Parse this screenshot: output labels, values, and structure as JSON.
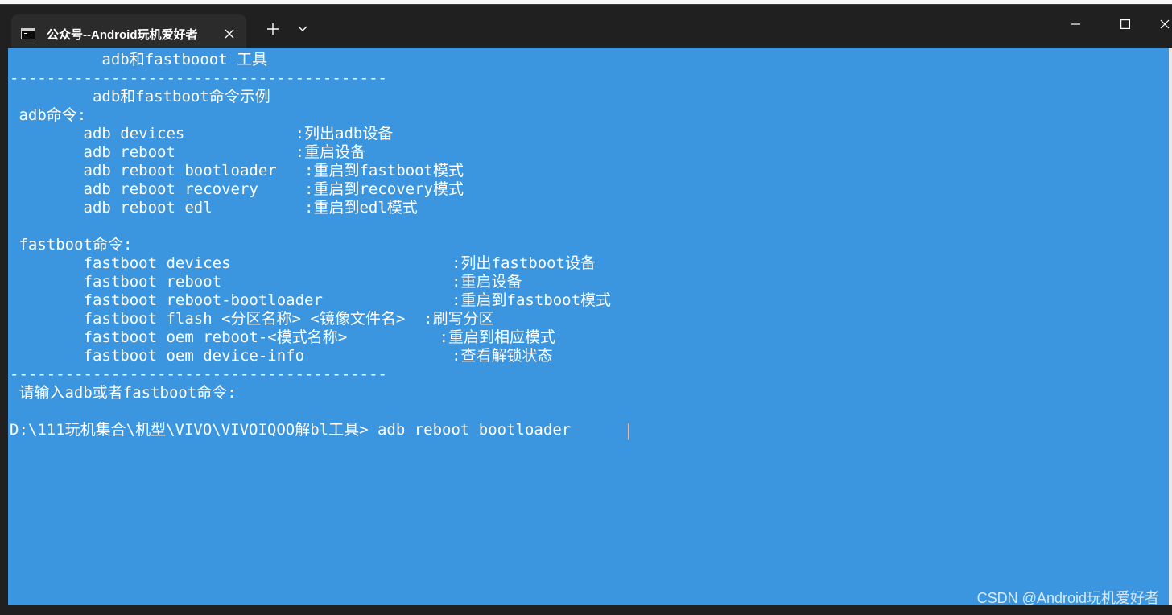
{
  "window": {
    "tab_title": "公众号--Android玩机爱好者",
    "icons": {
      "tab": "cmd-terminal-icon",
      "close_tab": "close-icon",
      "new_tab": "plus-icon",
      "dropdown": "chevron-down-icon",
      "minimize": "minimize-icon",
      "maximize": "maximize-icon",
      "close_window": "close-icon"
    }
  },
  "colors": {
    "titlebar": "#202020",
    "tab": "#2b2b2b",
    "terminal_bg": "#3b96df",
    "terminal_text": "#ffffff"
  },
  "terminal": {
    "lines": [
      "          adb和fastbooot 工具",
      "-----------------------------------------",
      "         adb和fastboot命令示例",
      " adb命令:",
      "        adb devices            :列出adb设备",
      "        adb reboot             :重启设备",
      "        adb reboot bootloader   :重启到fastboot模式",
      "        adb reboot recovery     :重启到recovery模式",
      "        adb reboot edl          :重启到edl模式",
      "",
      " fastboot命令:",
      "        fastboot devices                        :列出fastboot设备",
      "        fastboot reboot                         :重启设备",
      "        fastboot reboot-bootloader              :重启到fastboot模式",
      "        fastboot flash <分区名称> <镜像文件名>  :刷写分区",
      "        fastboot oem reboot-<模式名称>          :重启到相应模式",
      "        fastboot oem device-info                :查看解锁状态",
      "-----------------------------------------",
      " 请输入adb或者fastboot命令:",
      "",
      "D:\\111玩机集合\\机型\\VIVO\\VIVOIQOO解bl工具> adb reboot bootloader"
    ]
  },
  "watermark": "CSDN @Android玩机爱好者"
}
